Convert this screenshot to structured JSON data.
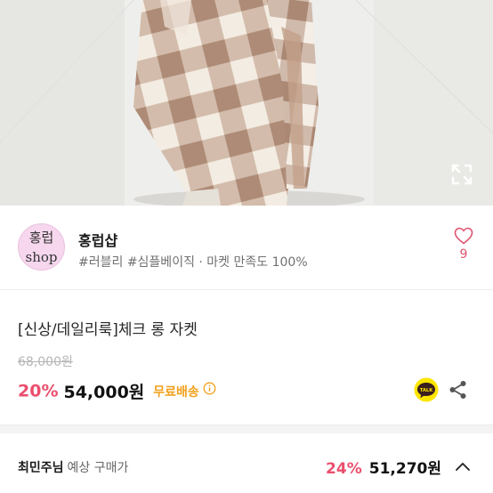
{
  "product_image": {
    "alt": "",
    "icons": [
      "expand-icon"
    ]
  },
  "shop": {
    "avatar_top": "홍럽",
    "avatar_bottom": "shop",
    "name": "홍럽샵",
    "tags": "#러블리 #심플베이직 · 마켓 만족도 100%",
    "like_count": "9",
    "accent": "#e1546f"
  },
  "product": {
    "title": "[신상/데일리룩]체크 롱 자켓",
    "original_price": "68,000원",
    "discount": "20%",
    "price": "54,000원",
    "shipping": "무료배송"
  },
  "member": {
    "name": "최민주님",
    "label": "예상 구매가",
    "discount": "24%",
    "price": "51,270원"
  },
  "colors": {
    "discount": "#ea4f6d",
    "shipping": "#f2a01c",
    "kakao": "#fee500"
  }
}
